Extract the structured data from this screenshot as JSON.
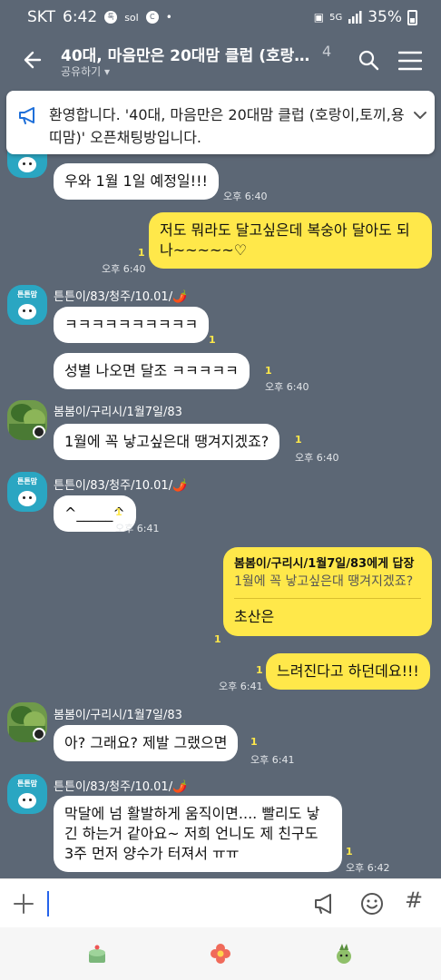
{
  "status_bar": {
    "carrier": "SKT",
    "time": "6:42",
    "icons": [
      "talk-icon",
      "sol-icon",
      "c-icon",
      "dot-icon"
    ],
    "battery": "35%",
    "signal_label": "5G"
  },
  "header": {
    "title": "40대, 마음만은 20대맘 클럽 (호랑이,...",
    "member_count": "4",
    "subtitle": "공유하기 ▾"
  },
  "notice": {
    "text": "환영합니다. '40대, 마음만은 20대맘 클럽 (호랑이,토끼,용띠맘)' 오픈채팅방입니다."
  },
  "senders": {
    "a": "튼튼이/83/청주/10.01/🌶️",
    "b": "봄봄이/구리시/1월7일/83"
  },
  "avatar_label": "튼튼맘",
  "messages": [
    {
      "text": "우와 1월 1일 예정일!!!",
      "time": "오후 6:40"
    },
    {
      "text": "저도 뭐라도 달고싶은데 복숭아 달아도 되나~~~~~♡",
      "time": "오후 6:40",
      "unread": "1"
    },
    {
      "text": "ㅋㅋㅋㅋㅋㅋㅋㅋㅋㅋ",
      "unread": "1"
    },
    {
      "text": "성별 나오면 달조 ㅋㅋㅋㅋㅋ",
      "time": "오후 6:40",
      "unread": "1"
    },
    {
      "text": "1월에 꼭 낳고싶은대 땡겨지겠죠?",
      "time": "오후 6:40",
      "unread": "1"
    },
    {
      "text": "^_____^",
      "time": "오후 6:41",
      "unread": "1"
    },
    {
      "reply_to": "봄봄이/구리시/1월7일/83에게 답장",
      "quote": "1월에 꼭 낳고싶은대 땡겨지겠죠?",
      "text": "초산은",
      "unread": "1"
    },
    {
      "text": "느려진다고 하던데요!!!",
      "time": "오후 6:41",
      "unread": "1"
    },
    {
      "text": "아? 그래요? 제발 그랬으면",
      "time": "오후 6:41",
      "unread": "1"
    },
    {
      "text": "막달에 넘 활발하게 움직이면.... 빨리도 낳긴 하는거 같아요~ 저희 언니도 제 친구도 3주 먼저 양수가 터져서 ㅠㅠ",
      "time": "오후 6:42",
      "unread": "1"
    }
  ],
  "composer": {
    "hash": "#"
  },
  "colors": {
    "background": "#5c6775",
    "my_bubble": "#ffe84a",
    "unread": "#ffe84a"
  }
}
